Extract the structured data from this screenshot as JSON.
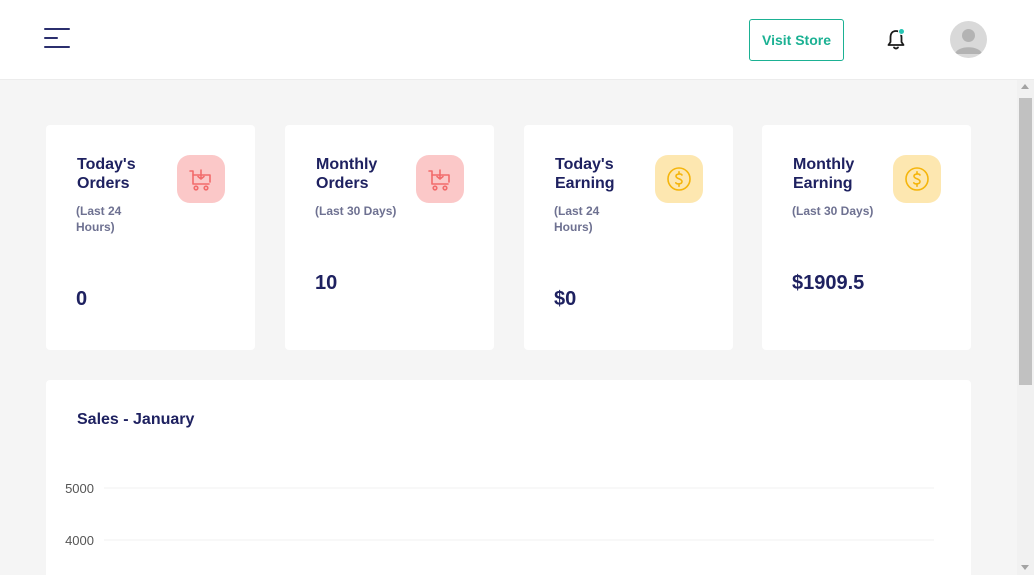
{
  "header": {
    "menu_icon": "hamburger-menu-icon",
    "visit_store_label": "Visit Store",
    "bell_icon": "bell-icon",
    "avatar_icon": "user-avatar-icon"
  },
  "cards": [
    {
      "title": "Today's Orders",
      "subtitle": "(Last 24 Hours)",
      "value": "0",
      "icon": "cart-download-icon",
      "icon_color": "#f26b6b",
      "icon_bg": "#fbc8c8"
    },
    {
      "title": "Monthly Orders",
      "subtitle": "(Last 30 Days)",
      "value": "10",
      "icon": "cart-download-icon",
      "icon_color": "#f26b6b",
      "icon_bg": "#fbc8c8"
    },
    {
      "title": "Today's Earning",
      "subtitle": "(Last 24 Hours)",
      "value": "$0",
      "icon": "dollar-coin-icon",
      "icon_color": "#f5b50b",
      "icon_bg": "#fde7b0"
    },
    {
      "title": "Monthly Earning",
      "subtitle": "(Last 30 Days)",
      "value": "$1909.5",
      "icon": "dollar-coin-icon",
      "icon_color": "#f5b50b",
      "icon_bg": "#fde7b0"
    }
  ],
  "sales_chart": {
    "title": "Sales - January"
  },
  "chart_data": {
    "type": "line",
    "title": "Sales - January",
    "xlabel": "",
    "ylabel": "",
    "y_ticks": [
      5000,
      4000
    ],
    "grid": true
  }
}
